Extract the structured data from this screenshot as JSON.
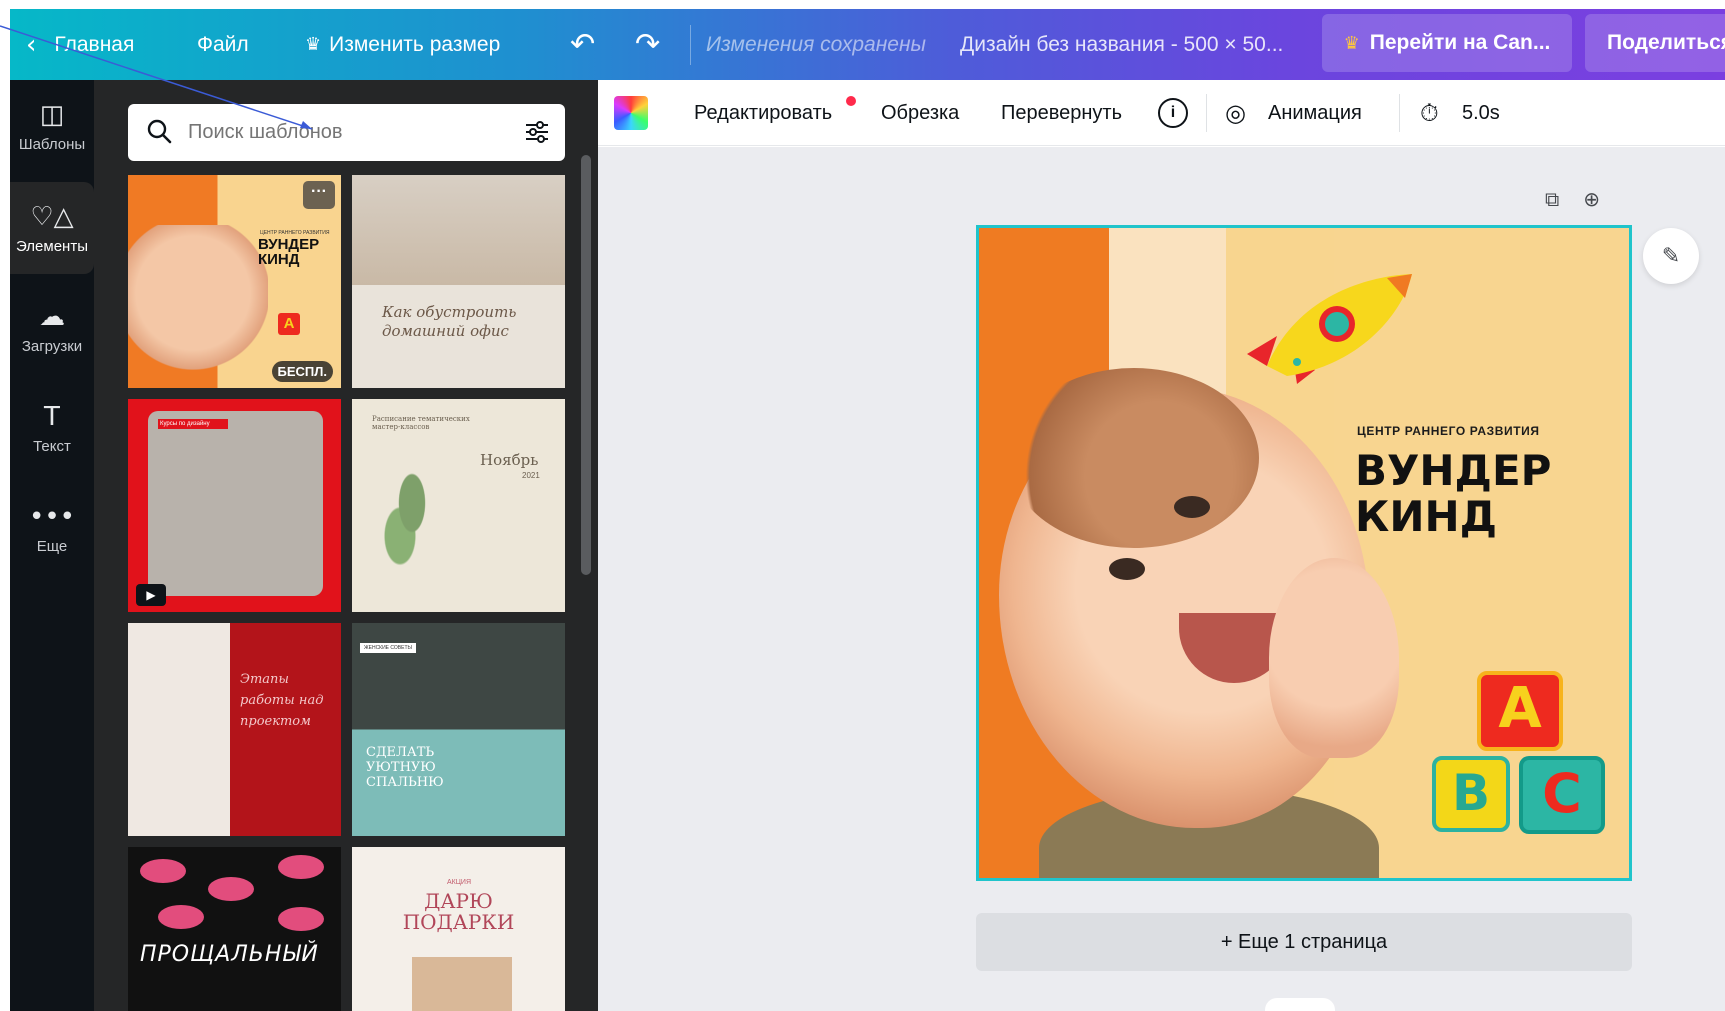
{
  "topbar": {
    "home_label": "Главная",
    "file_label": "Файл",
    "resize_label": "Изменить размер",
    "status": "Изменения сохранены",
    "document_name": "Дизайн без названия - 500 × 50...",
    "go_canva_label": "Перейти на Can...",
    "share_label": "Поделиться",
    "icons": [
      "chevron-left-icon",
      "crown-icon",
      "undo-icon",
      "redo-icon"
    ]
  },
  "rail": {
    "items": [
      {
        "label": "Шаблоны",
        "icon": "templates-icon"
      },
      {
        "label": "Элементы",
        "icon": "elements-icon"
      },
      {
        "label": "Загрузки",
        "icon": "upload-cloud-icon"
      },
      {
        "label": "Текст",
        "icon": "text-icon"
      },
      {
        "label": "Еще",
        "icon": "more-dots-icon"
      }
    ]
  },
  "panel": {
    "search_placeholder": "Поиск шаблонов",
    "templates": [
      {
        "subtitle": "ЦЕНТР РАННЕГО РАЗВИТИЯ",
        "title": "ВУНДЕР КИНД",
        "badge": "БЕСПЛ.",
        "more": "···"
      },
      {
        "title": "Как обустроить домашний офис"
      },
      {
        "caption": "Курсы по дизайну"
      },
      {
        "heading": "Расписание тематических мастер-классов",
        "month": "Ноябрь",
        "year": "2021"
      },
      {
        "title": "Этапы работы над проектом"
      },
      {
        "tag": "ЖЕНСКИЕ СОВЕТЫ",
        "title": "СДЕЛАТЬ УЮТНУЮ СПАЛЬНЮ"
      },
      {
        "title": "ПРОЩАЛЬНЫЙ"
      },
      {
        "subtitle": "АКЦИЯ",
        "title": "ДАРЮ ПОДАРКИ"
      }
    ]
  },
  "context_toolbar": {
    "edit_label": "Редактировать",
    "crop_label": "Обрезка",
    "flip_label": "Перевернуть",
    "info_symbol": "i",
    "animation_label": "Анимация",
    "duration": "5.0s"
  },
  "canvas": {
    "subtitle": "ЦЕНТР РАННЕГО РАЗВИТИЯ",
    "title_line1": "ВУНДЕР",
    "title_line2": "КИНД",
    "blocks": [
      "A",
      "B",
      "C"
    ],
    "add_page_label": "+ Еще 1 страница",
    "selection_color": "#20c4cb"
  },
  "colors": {
    "topbar_start": "#06b8c8",
    "topbar_end": "#7b3fe0",
    "panel_bg": "#252627",
    "rail_bg": "#0e1318",
    "workspace_bg": "#ebecf0",
    "crown": "#ffc83d"
  }
}
